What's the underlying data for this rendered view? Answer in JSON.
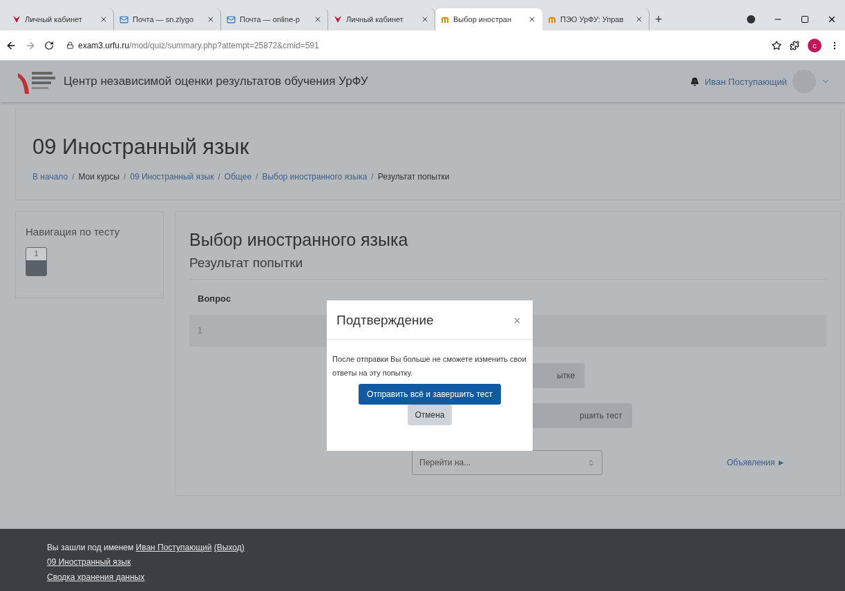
{
  "browser": {
    "tabs": [
      {
        "title": "Личный кабинет",
        "kind": "y",
        "selected": false
      },
      {
        "title": "Почта — sn.zlygo",
        "kind": "mail",
        "selected": false
      },
      {
        "title": "Почта — online-р",
        "kind": "mail",
        "selected": false
      },
      {
        "title": "Личный кабинет",
        "kind": "y",
        "selected": false
      },
      {
        "title": "Выбор иностран",
        "kind": "m",
        "selected": true
      },
      {
        "title": "ПЭО УрФУ: Управ",
        "kind": "m",
        "selected": false
      }
    ],
    "new_tab": "+",
    "url_host": "exam3.urfu.ru",
    "url_path": "/mod/quiz/summary.php?attempt=25872&cmid=591",
    "profile_letter": "c"
  },
  "navbar": {
    "site_name": "Центр независимой оценки результатов обучения УрФУ",
    "user_name": "Иван Поступающий"
  },
  "header": {
    "title": "09 Иностранный язык",
    "breadcrumbs": [
      {
        "label": "В начало",
        "link": true
      },
      {
        "separator": "/",
        "label": "Мои курсы",
        "link": false
      },
      {
        "separator": "/",
        "label": "09 Иностранный язык",
        "link": true
      },
      {
        "separator": "/",
        "label": "Общее",
        "link": true
      },
      {
        "separator": "/",
        "label": "Выбор иностранного языка",
        "link": true
      },
      {
        "separator": "/",
        "label": "Результат попытки",
        "link": false
      }
    ]
  },
  "quiz_nav": {
    "title": "Навигация по тесту",
    "questions": [
      {
        "label": "1",
        "answered": true
      }
    ]
  },
  "main": {
    "title": "Выбор иностранного языка",
    "subtitle": "Результат попытки",
    "table": {
      "columns": [
        "Вопрос"
      ],
      "rows": [
        [
          "1"
        ]
      ]
    },
    "buttons": [
      "ытке",
      "ршить тест"
    ],
    "jump": {
      "value": "Перейти на..."
    },
    "next_link": "Объявления ►"
  },
  "modal": {
    "title": "Подтверждение",
    "message": "После отправки Вы больше не сможете изменить свои ответы на эту попытку.",
    "primary": "Отправить всё и завершить тест",
    "cancel": "Отмена"
  },
  "footer": {
    "login_prefix": "Вы зашли под именем ",
    "login_user": "Иван Поступающий",
    "logout": "(Выход)",
    "links": [
      "09 Иностранный язык",
      "Сводка хранения данных"
    ]
  }
}
